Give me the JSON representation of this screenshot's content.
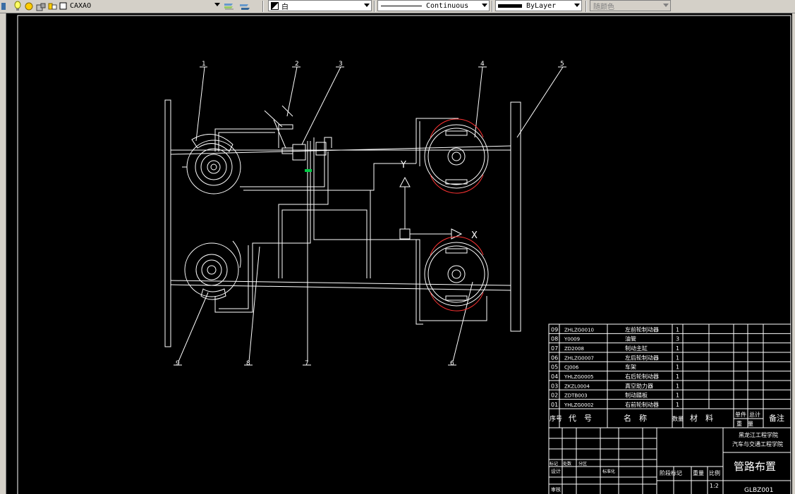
{
  "toolbar": {
    "layer_name": "CAXAO",
    "color_value": "白",
    "linetype_value": "Continuous",
    "lineweight_value": "ByLayer",
    "colorby_value": "随颜色"
  },
  "drawing": {
    "balloons": [
      "1",
      "2",
      "3",
      "4",
      "5",
      "6",
      "7",
      "8",
      "9"
    ],
    "axis_x": "X",
    "axis_y": "Y"
  },
  "bom": {
    "rows": [
      {
        "no": "09",
        "code": "ZHLZG0010",
        "name": "左前轮制动器",
        "qty": "1"
      },
      {
        "no": "08",
        "code": "Y0009",
        "name": "油管",
        "qty": "3"
      },
      {
        "no": "07",
        "code": "ZD2008",
        "name": "制动主缸",
        "qty": "1"
      },
      {
        "no": "06",
        "code": "ZHLZG0007",
        "name": "左后轮制动器",
        "qty": "1"
      },
      {
        "no": "05",
        "code": "CJ006",
        "name": "车架",
        "qty": "1"
      },
      {
        "no": "04",
        "code": "YHLZG0005",
        "name": "右后轮制动器",
        "qty": "1"
      },
      {
        "no": "03",
        "code": "ZKZL0004",
        "name": "真空助力器",
        "qty": "1"
      },
      {
        "no": "02",
        "code": "ZDTB003",
        "name": "制动踏板",
        "qty": "1"
      },
      {
        "no": "01",
        "code": "YHLZG0002",
        "name": "右前轮制动器",
        "qty": "1"
      }
    ],
    "headers": {
      "no": "序号",
      "code": "代　号",
      "name": "名　称",
      "qty": "数量",
      "material": "材　料",
      "unit": "单件",
      "total": "总计",
      "weight": "重　量",
      "note": "备注"
    }
  },
  "titleblock": {
    "school": "黑龙江工程学院",
    "dept": "汽车与交通工程学院",
    "title": "管路布置",
    "drawing_no": "GLBZ001",
    "scale": "1:2",
    "stage_label": "阶段标记",
    "weight_label": "重量",
    "scale_label": "比例",
    "design_label": "设计",
    "standard_label": "标准化",
    "review_label": "审核",
    "mark_label": "标记",
    "count_label": "处数",
    "zone_label": "分区"
  }
}
